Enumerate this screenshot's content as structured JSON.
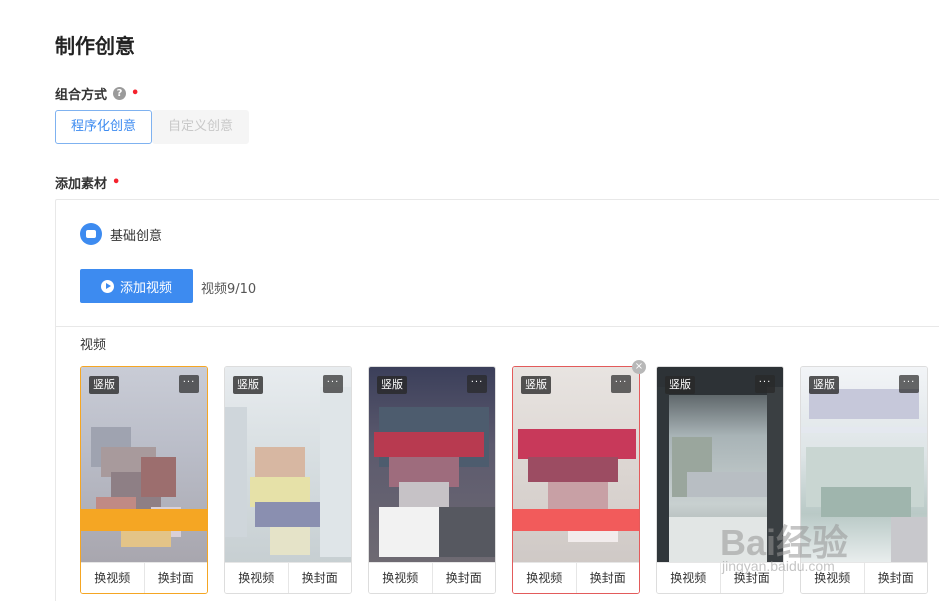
{
  "page": {
    "title": "制作创意"
  },
  "combination": {
    "label": "组合方式",
    "help_icon": "question-circle-icon",
    "options": [
      {
        "label": "程序化创意",
        "selected": true
      },
      {
        "label": "自定义创意",
        "selected": false
      }
    ]
  },
  "materials": {
    "label": "添加素材",
    "base_creative_label": "基础创意",
    "add_video_label": "添加视频",
    "video_count": "视频9/10",
    "videos_label": "视频",
    "cards": [
      {
        "tag": "竖版",
        "replace_video": "换视频",
        "replace_cover": "换封面"
      },
      {
        "tag": "竖版",
        "replace_video": "换视频",
        "replace_cover": "换封面"
      },
      {
        "tag": "竖版",
        "replace_video": "换视频",
        "replace_cover": "换封面"
      },
      {
        "tag": "竖版",
        "replace_video": "换视频",
        "replace_cover": "换封面"
      },
      {
        "tag": "竖版",
        "replace_video": "换视频",
        "replace_cover": "换封面"
      },
      {
        "tag": "竖版",
        "replace_video": "换视频",
        "replace_cover": "换封面"
      }
    ]
  },
  "watermark": {
    "logo": "Bai经验",
    "url": "jingyan.baidu.com"
  },
  "colors": {
    "primary": "#3d8bf0",
    "required": "#f5222d",
    "selected_orange": "#f5a623",
    "selected_red": "#e35b5b"
  }
}
